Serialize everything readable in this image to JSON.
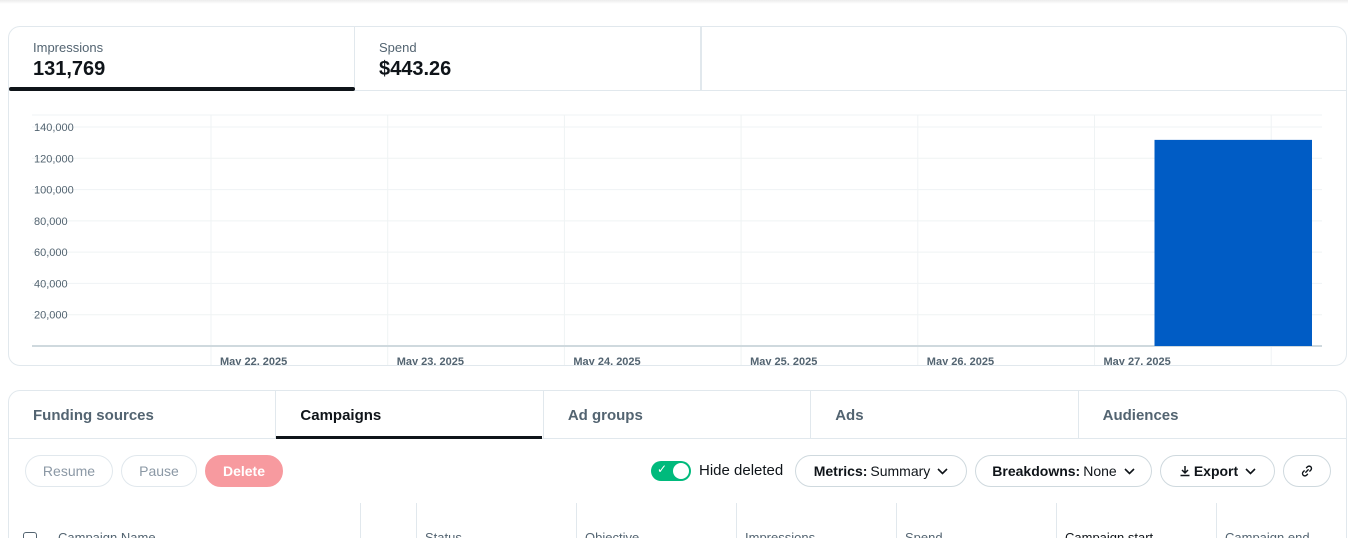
{
  "metrics": [
    {
      "label": "Impressions",
      "value": "131,769"
    },
    {
      "label": "Spend",
      "value": "$443.26"
    }
  ],
  "colors": {
    "bar": "#005cc5",
    "toggle_on": "#00ba7c",
    "delete": "#f79a9f"
  },
  "chart_data": {
    "type": "bar",
    "title": "",
    "xlabel": "",
    "ylabel": "",
    "categories": [
      "May 22, 2025",
      "May 23, 2025",
      "May 24, 2025",
      "May 25, 2025",
      "May 26, 2025",
      "May 27, 2025"
    ],
    "values": [
      0,
      0,
      0,
      0,
      0,
      131769
    ],
    "y_ticks": [
      "20,000",
      "40,000",
      "60,000",
      "80,000",
      "100,000",
      "120,000",
      "140,000"
    ],
    "ylim": [
      0,
      140000
    ],
    "grid": true,
    "legend": "none"
  },
  "entity_tabs": [
    "Funding sources",
    "Campaigns",
    "Ad groups",
    "Ads",
    "Audiences"
  ],
  "toolbar": {
    "resume": "Resume",
    "pause": "Pause",
    "delete": "Delete",
    "hide_deleted": "Hide deleted",
    "metrics_label": "Metrics:",
    "metrics_value": "Summary",
    "breakdowns_label": "Breakdowns:",
    "breakdowns_value": "None",
    "export": "Export"
  },
  "table": {
    "columns": [
      "Campaign Name",
      "",
      "Status",
      "Objective",
      "Impressions",
      "Spend",
      "Campaign start",
      "Campaign end"
    ]
  }
}
